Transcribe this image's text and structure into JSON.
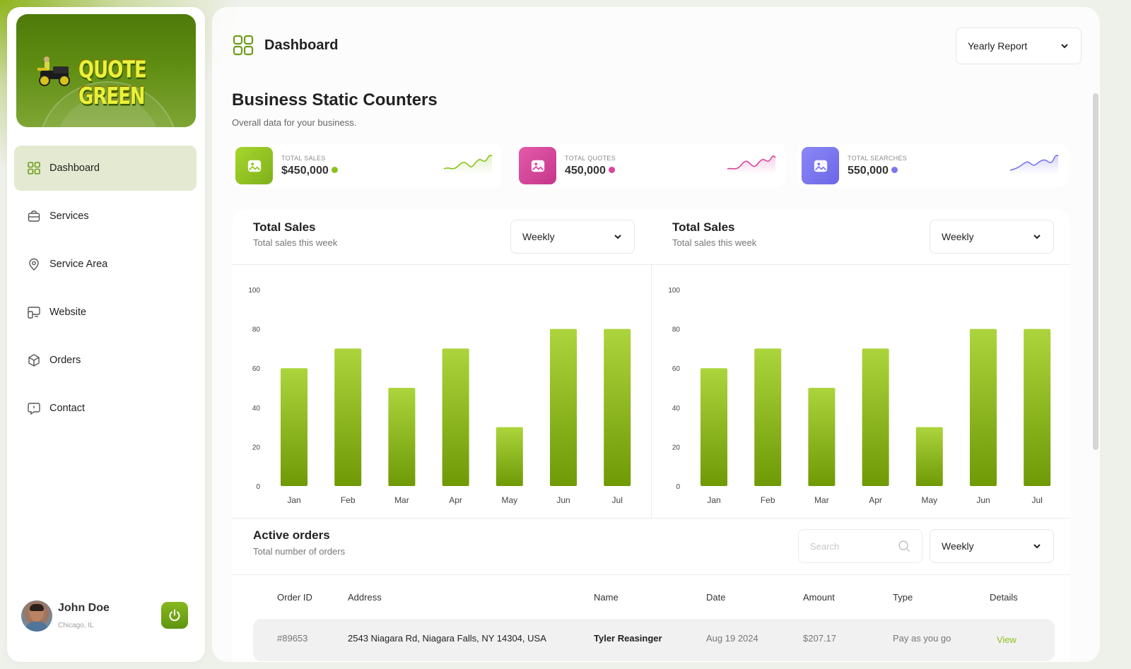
{
  "app": {
    "logo_text": "QUOTE GREEN"
  },
  "sidebar": {
    "items": [
      {
        "label": "Dashboard",
        "icon": "grid-icon",
        "active": true
      },
      {
        "label": "Services",
        "icon": "briefcase-icon",
        "active": false
      },
      {
        "label": "Service Area",
        "icon": "location-pin-icon",
        "active": false
      },
      {
        "label": "Website",
        "icon": "devices-icon",
        "active": false
      },
      {
        "label": "Orders",
        "icon": "box-icon",
        "active": false
      },
      {
        "label": "Contact",
        "icon": "chat-icon",
        "active": false
      }
    ],
    "profile": {
      "name": "John Doe",
      "location": "Chicago, IL"
    }
  },
  "header": {
    "title": "Dashboard",
    "report_select": "Yearly Report"
  },
  "counters": {
    "title": "Business Static Counters",
    "subtitle": "Overall data for your business.",
    "items": [
      {
        "label": "TOTAL SALES",
        "value": "$450,000",
        "color": "#8bc21e"
      },
      {
        "label": "TOTAL QUOTES",
        "value": "450,000",
        "color": "#d9449e"
      },
      {
        "label": "TOTAL SEARCHES",
        "value": "550,000",
        "color": "#7b76f0"
      }
    ]
  },
  "charts": [
    {
      "title": "Total Sales",
      "subtitle": "Total sales this week",
      "period": "Weekly"
    },
    {
      "title": "Total Sales",
      "subtitle": "Total sales this week",
      "period": "Weekly"
    }
  ],
  "chart_data": [
    {
      "type": "bar",
      "title": "Total Sales",
      "categories": [
        "Jan",
        "Feb",
        "Mar",
        "Apr",
        "May",
        "Jun",
        "Jul"
      ],
      "values": [
        60,
        70,
        50,
        70,
        30,
        80,
        80
      ],
      "yticks": [
        "0",
        "20",
        "40",
        "60",
        "80",
        "100"
      ],
      "ylim": [
        0,
        100
      ],
      "color": "#8bc21e"
    },
    {
      "type": "bar",
      "title": "Total Sales",
      "categories": [
        "Jan",
        "Feb",
        "Mar",
        "Apr",
        "May",
        "Jun",
        "Jul"
      ],
      "values": [
        60,
        70,
        50,
        70,
        30,
        80,
        80
      ],
      "yticks": [
        "0",
        "20",
        "40",
        "60",
        "80",
        "100"
      ],
      "ylim": [
        0,
        100
      ],
      "color": "#8bc21e"
    }
  ],
  "orders": {
    "title": "Active orders",
    "subtitle": "Total number of orders",
    "search_placeholder": "Search",
    "period": "Weekly",
    "columns": [
      "Order ID",
      "Address",
      "Name",
      "Date",
      "Amount",
      "Type",
      "Details"
    ],
    "rows": [
      {
        "order_id": "#89653",
        "address": "2543 Niagara Rd, Niagara Falls, NY 14304, USA",
        "name": "Tyler Reasinger",
        "date": "Aug 19 2024",
        "amount": "$207.17",
        "type": "Pay as you go",
        "details": "View"
      }
    ]
  }
}
